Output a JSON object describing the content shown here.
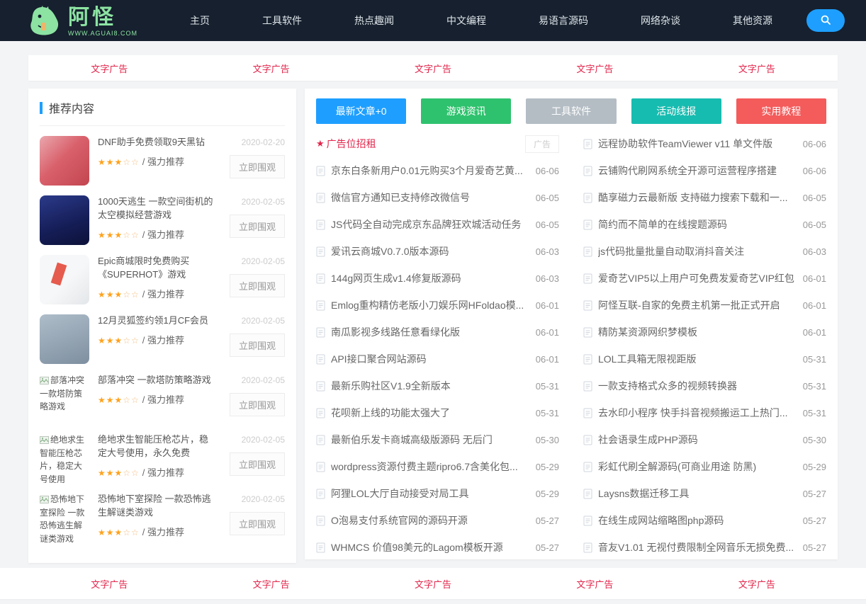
{
  "brand": {
    "name": "阿怪",
    "domain": "WWW.AGUAI8.COM"
  },
  "nav": {
    "items": [
      {
        "label": "主页"
      },
      {
        "label": "工具软件"
      },
      {
        "label": "热点趣闻"
      },
      {
        "label": "中文编程"
      },
      {
        "label": "易语言源码"
      },
      {
        "label": "网络杂谈"
      },
      {
        "label": "其他资源"
      }
    ]
  },
  "colors": {
    "accent_blue": "#1e9fff",
    "ad_red": "#e2254b",
    "header_bg": "#16202e"
  },
  "ads_top": [
    "文字广告",
    "文字广告",
    "文字广告",
    "文字广告",
    "文字广告"
  ],
  "ads_bottom": [
    "文字广告",
    "文字广告",
    "文字广告",
    "文字广告",
    "文字广告"
  ],
  "sidebar": {
    "title": "推荐内容",
    "view_button_label": "立即围观",
    "stars_full": "★★★",
    "stars_empty": "☆☆",
    "rating_label": "/ 强力推荐",
    "items": [
      {
        "title": "DNF助手免费领取9天黑钻",
        "date": "2020-02-20"
      },
      {
        "title": "1000天逃生 一款空间街机的太空模拟经营游戏",
        "date": "2020-02-05"
      },
      {
        "title": "Epic商城限时免费购买《SUPERHOT》游戏",
        "date": "2020-02-05"
      },
      {
        "title": "12月灵狐签约领1月CF会员",
        "date": "2020-02-05"
      },
      {
        "title": "部落冲突 一款塔防策略游戏",
        "date": "2020-02-05",
        "alt": "部落冲突 一款塔防策略游戏"
      },
      {
        "title": "绝地求生智能压枪芯片，稳定大号使用，永久免费",
        "date": "2020-02-05",
        "alt": "绝地求生智能压枪芯片，稳定大号使用"
      },
      {
        "title": "恐怖地下室探险 一款恐怖逃生解谜类游戏",
        "date": "2020-02-05",
        "alt": "恐怖地下室探险 一款恐怖逃生解谜类游戏"
      }
    ]
  },
  "toolbar": {
    "buttons": [
      {
        "label": "最新文章+0",
        "color": "#1e9fff"
      },
      {
        "label": "游戏资讯",
        "color": "#2fc26e"
      },
      {
        "label": "工具软件",
        "color": "#b4bdc4"
      },
      {
        "label": "活动线报",
        "color": "#17bcb0"
      },
      {
        "label": "实用教程",
        "color": "#f45b5b"
      }
    ]
  },
  "ad_row": {
    "star": "★",
    "label": "广告位招租",
    "badge": "广告"
  },
  "left_list": [
    {
      "title": "京东白条新用户0.01元购买3个月爱奇艺黄...",
      "date": "06-06"
    },
    {
      "title": "微信官方通知已支持修改微信号",
      "date": "06-05"
    },
    {
      "title": "JS代码全自动完成京东品牌狂欢城活动任务",
      "date": "06-05"
    },
    {
      "title": "爱讯云商城V0.7.0版本源码",
      "date": "06-03"
    },
    {
      "title": "144g网页生成v1.4修复版源码",
      "date": "06-03"
    },
    {
      "title": "Emlog重构精仿老版小刀娱乐网HFoldao模...",
      "date": "06-01"
    },
    {
      "title": "南瓜影视多线路任意看绿化版",
      "date": "06-01"
    },
    {
      "title": "API接口聚合网站源码",
      "date": "06-01"
    },
    {
      "title": "最新乐购社区V1.9全新版本",
      "date": "05-31"
    },
    {
      "title": "花呗新上线的功能太强大了",
      "date": "05-31"
    },
    {
      "title": "最新伯乐发卡商城高级版源码 无后门",
      "date": "05-30"
    },
    {
      "title": "wordpress资源付费主题ripro6.7含美化包...",
      "date": "05-29"
    },
    {
      "title": "阿狸LOL大厅自动接受对局工具",
      "date": "05-29"
    },
    {
      "title": "O泡易支付系统官网的源码开源",
      "date": "05-27"
    },
    {
      "title": "WHMCS 价值98美元的Lagom模板开源",
      "date": "05-27"
    }
  ],
  "right_list": [
    {
      "title": "远程协助软件TeamViewer v11 单文件版",
      "date": "06-06"
    },
    {
      "title": "云铺购代刷网系统全开源可运营程序搭建",
      "date": "06-06"
    },
    {
      "title": "酷享磁力云最新版 支持磁力搜索下载和一...",
      "date": "06-05"
    },
    {
      "title": "简约而不简单的在线搜题源码",
      "date": "06-05"
    },
    {
      "title": "js代码批量批量自动取消抖音关注",
      "date": "06-03"
    },
    {
      "title": "爱奇艺VIP5以上用户可免费发爱奇艺VIP红包",
      "date": "06-01"
    },
    {
      "title": "阿怪互联-自家的免费主机第一批正式开启",
      "date": "06-01"
    },
    {
      "title": "精防某资源网织梦模板",
      "date": "06-01"
    },
    {
      "title": "LOL工具箱无限视距版",
      "date": "05-31"
    },
    {
      "title": "一款支持格式众多的视频转换器",
      "date": "05-31"
    },
    {
      "title": "去水印小程序 快手抖音视频搬运工上热门...",
      "date": "05-31"
    },
    {
      "title": "社会语录生成PHP源码",
      "date": "05-30"
    },
    {
      "title": "彩虹代刷全解源码(可商业用途 防黑)",
      "date": "05-29"
    },
    {
      "title": "Laysns数据迁移工具",
      "date": "05-27"
    },
    {
      "title": "在线生成网站缩略图php源码",
      "date": "05-27"
    },
    {
      "title": "音友V1.01 无视付费限制全网音乐无损免费...",
      "date": "05-27"
    }
  ]
}
